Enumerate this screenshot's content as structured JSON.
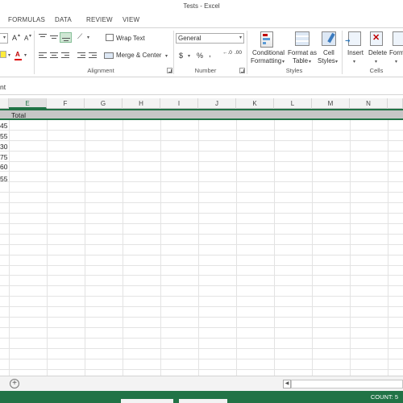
{
  "window": {
    "title": "Tests - Excel"
  },
  "tabs": [
    "FORMULAS",
    "DATA",
    "REVIEW",
    "VIEW"
  ],
  "ribbon": {
    "font_size_up": "A",
    "font_size_down": "A",
    "wrap_text": "Wrap Text",
    "merge_center": "Merge & Center",
    "number_format": "General",
    "currency": "$",
    "percent": "%",
    "comma": ",",
    "inc_decimal": "←.0",
    "dec_decimal": ".00",
    "conditional_formatting_1": "Conditional",
    "conditional_formatting_2": "Formatting",
    "format_as_table_1": "Format as",
    "format_as_table_2": "Table",
    "cell_styles_1": "Cell",
    "cell_styles_2": "Styles",
    "insert": "Insert",
    "delete": "Delete",
    "format": "Form",
    "groups": {
      "alignment": "Alignment",
      "number": "Number",
      "styles": "Styles",
      "cells": "Cells"
    }
  },
  "formula_bar": {
    "content": "nt"
  },
  "grid": {
    "columns": [
      "E",
      "F",
      "G",
      "H",
      "I",
      "J",
      "K",
      "L",
      "M",
      "N"
    ],
    "header_cell": "Total",
    "values": [
      "45",
      "55",
      "30",
      "75",
      "60",
      "55"
    ]
  },
  "sheet_bar": {
    "add_sheet": "+",
    "scroll_left": "◀"
  },
  "status": {
    "count": "COUNT: 5"
  },
  "colors": {
    "accent": "#217346"
  }
}
